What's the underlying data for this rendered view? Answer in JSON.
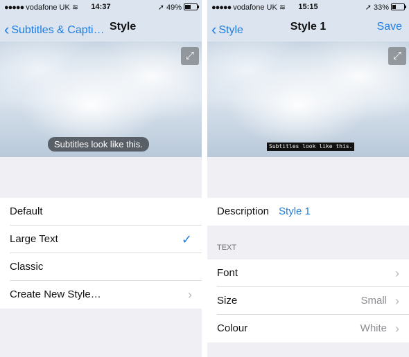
{
  "left": {
    "status": {
      "carrier": "vodafone UK",
      "time": "14:37",
      "battery": "49%",
      "battery_level": 0.49
    },
    "nav": {
      "back_label": "Subtitles & Capti…",
      "title": "Style"
    },
    "preview": {
      "subtitle_text": "Subtitles look like this."
    },
    "styles": [
      {
        "label": "Default"
      },
      {
        "label": "Large Text",
        "checked": true
      },
      {
        "label": "Classic"
      },
      {
        "label": "Create New Style…"
      }
    ]
  },
  "right": {
    "status": {
      "carrier": "vodafone UK",
      "time": "15:15",
      "battery": "33%",
      "battery_level": 0.33
    },
    "nav": {
      "back_label": "Style",
      "title": "Style 1",
      "action_label": "Save"
    },
    "preview": {
      "subtitle_text": "Subtitles look like this."
    },
    "description": {
      "label": "Description",
      "value": "Style 1"
    },
    "text_section": {
      "header": "TEXT",
      "rows": [
        {
          "label": "Font",
          "value": ""
        },
        {
          "label": "Size",
          "value": "Small"
        },
        {
          "label": "Colour",
          "value": "White"
        }
      ]
    }
  },
  "colors": {
    "accent": "#1d7de0",
    "navbar": "#dbe4ef",
    "group_background": "#efeff4"
  }
}
